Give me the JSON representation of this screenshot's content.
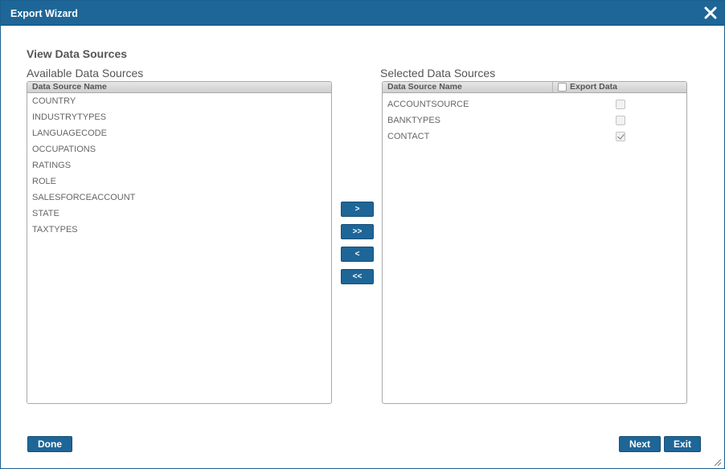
{
  "window": {
    "title": "Export Wizard",
    "close_icon": "close-icon"
  },
  "section_title": "View Data Sources",
  "available": {
    "label": "Available Data Sources",
    "header": "Data Source Name",
    "items": [
      "COUNTRY",
      "INDUSTRYTYPES",
      "LANGUAGECODE",
      "OCCUPATIONS",
      "RATINGS",
      "ROLE",
      "SALESFORCEACCOUNT",
      "STATE",
      "TAXTYPES"
    ]
  },
  "selected": {
    "label": "Selected Data Sources",
    "header_name": "Data Source Name",
    "header_export": "Export Data",
    "header_export_checked": false,
    "items": [
      {
        "name": "ACCOUNTSOURCE",
        "export": false
      },
      {
        "name": "BANKTYPES",
        "export": false
      },
      {
        "name": "CONTACT",
        "export": true
      }
    ]
  },
  "move_buttons": {
    "add": ">",
    "add_all": ">>",
    "remove": "<",
    "remove_all": "<<"
  },
  "footer": {
    "done": "Done",
    "next": "Next",
    "exit": "Exit"
  },
  "colors": {
    "titlebar": "#1e6697",
    "button": "#1e6697"
  }
}
